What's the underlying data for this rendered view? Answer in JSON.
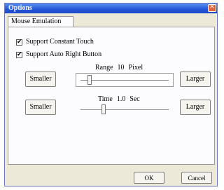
{
  "window": {
    "title": "Options"
  },
  "tabs": [
    {
      "label": "Mouse Emulation",
      "selected": true
    }
  ],
  "checkboxes": [
    {
      "label": "Support Constant Touch",
      "checked": true,
      "check_glyph": "✔"
    },
    {
      "label": "Support Auto Right Button",
      "checked": true,
      "check_glyph": "✔"
    }
  ],
  "range_slider": {
    "caption_name": "Range",
    "value": "10",
    "unit": "Pixel",
    "smaller_label": "Smaller",
    "larger_label": "Larger",
    "level": 0.08
  },
  "time_slider": {
    "caption_name": "Time",
    "value": "1.0",
    "unit": "Sec",
    "smaller_label": "Smaller",
    "larger_label": "Larger",
    "level": 0.25
  },
  "footer": {
    "ok_label": "OK",
    "cancel_label": "Cancel"
  },
  "colors": {
    "titlebar": "#2456d8",
    "close_button": "#e3643c",
    "dialog_background": "#ece9d8"
  },
  "icons": {
    "close": "close-icon",
    "check": "check-icon"
  }
}
